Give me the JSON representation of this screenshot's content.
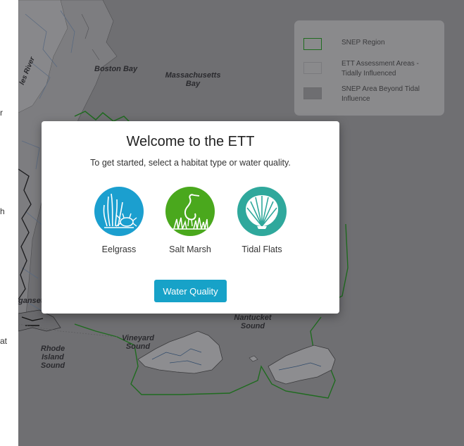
{
  "sidebar": {
    "fragments": [
      "r",
      "h",
      "at"
    ]
  },
  "map": {
    "labels": {
      "boston_bay": "Boston Bay",
      "massachusetts_bay": "Massachusetts Bay",
      "charles_river": "les River",
      "narragansett": "ganset",
      "nantucket_sound": "Nantucket Sound",
      "vineyard_sound": "Vineyard Sound",
      "rhode_island_sound": "Rhode Island Sound"
    }
  },
  "legend": {
    "items": [
      {
        "label": "SNEP Region",
        "swatch": "outline-green"
      },
      {
        "label": "ETT Assessment Areas - Tidally Influenced",
        "swatch": "outline-gray"
      },
      {
        "label": "SNEP Area Beyond Tidal Influence",
        "swatch": "filled-gray"
      }
    ]
  },
  "modal": {
    "title": "Welcome to the ETT",
    "subtitle": "To get started, select a habitat type or water quality.",
    "habitats": [
      {
        "label": "Eelgrass",
        "icon": "eelgrass-lobster-icon",
        "color": "#1b9fcf"
      },
      {
        "label": "Salt Marsh",
        "icon": "heron-marsh-icon",
        "color": "#4aa81d"
      },
      {
        "label": "Tidal Flats",
        "icon": "scallop-shell-icon",
        "color": "#2fa89c"
      }
    ],
    "water_quality_label": "Water Quality"
  },
  "colors": {
    "accent": "#17a2c8",
    "snep_outline": "#1f6b1f",
    "map_bg": "#6f6f72"
  }
}
